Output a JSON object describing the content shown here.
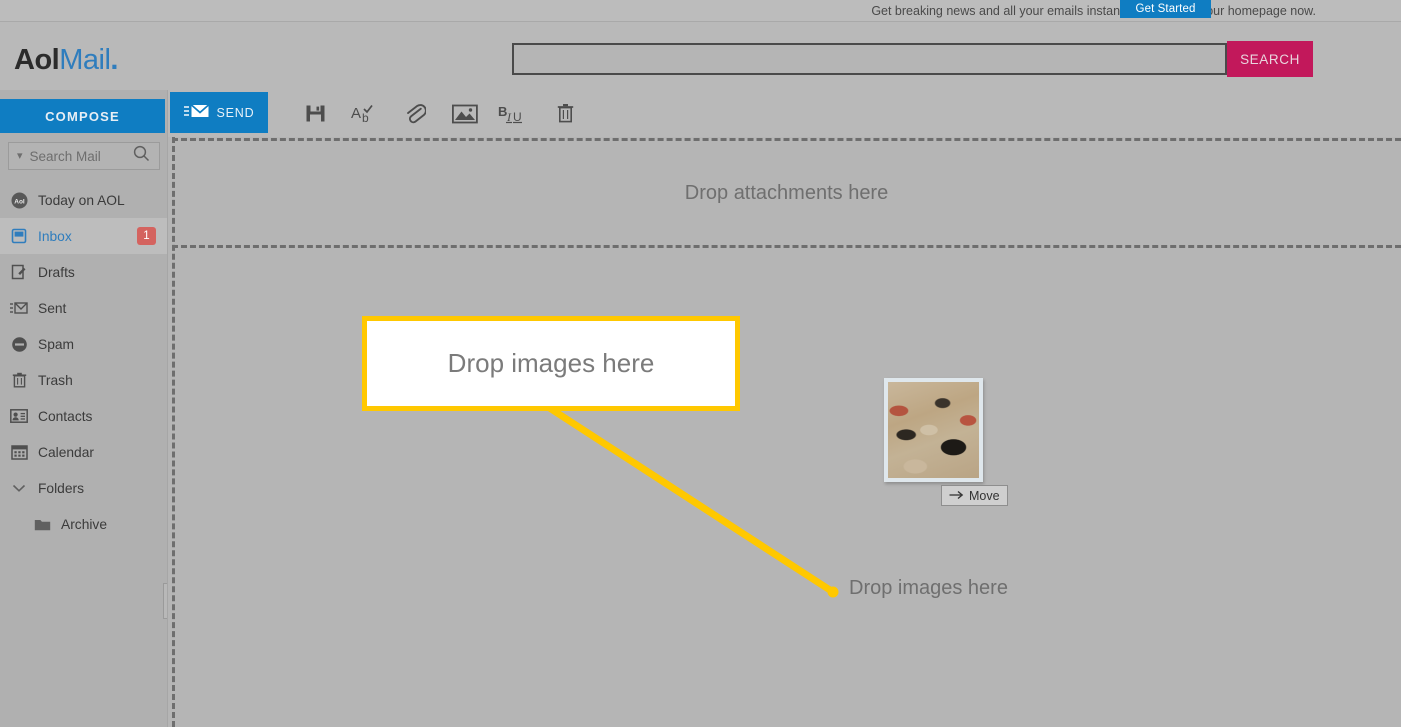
{
  "promo": {
    "text": "Get breaking news and all your emails instantly. Make AOL your homepage now.",
    "button_label": "Get Started",
    "button_color": "#0f7dc2"
  },
  "header": {
    "brand_first": "Aol",
    "brand_second": "Mail",
    "brand_dot": ".",
    "brand_color_primary": "#2b2b2b",
    "brand_color_secondary": "#2f7dbd",
    "search_value": "",
    "search_placeholder": "",
    "search_button_label": "SEARCH",
    "search_button_color": "#c2185b"
  },
  "sidebar": {
    "compose_label": "COMPOSE",
    "compose_color": "#0f7dc2",
    "search_mail_placeholder": "Search Mail",
    "items": [
      {
        "label": "Today on AOL",
        "icon": "aol-icon",
        "active": false,
        "badge": ""
      },
      {
        "label": "Inbox",
        "icon": "inbox-icon",
        "active": true,
        "badge": "1"
      },
      {
        "label": "Drafts",
        "icon": "drafts-icon",
        "active": false,
        "badge": ""
      },
      {
        "label": "Sent",
        "icon": "sent-icon",
        "active": false,
        "badge": ""
      },
      {
        "label": "Spam",
        "icon": "spam-icon",
        "active": false,
        "badge": ""
      },
      {
        "label": "Trash",
        "icon": "trash-icon",
        "active": false,
        "badge": ""
      },
      {
        "label": "Contacts",
        "icon": "contacts-icon",
        "active": false,
        "badge": ""
      },
      {
        "label": "Calendar",
        "icon": "calendar-icon",
        "active": false,
        "badge": ""
      },
      {
        "label": "Folders",
        "icon": "chevron-down-icon",
        "active": false,
        "badge": ""
      },
      {
        "label": "Archive",
        "icon": "folder-icon",
        "active": false,
        "badge": ""
      }
    ],
    "badge_color": "#d4635f"
  },
  "toolbar": {
    "send_label": "SEND",
    "icons": [
      {
        "name": "save-icon"
      },
      {
        "name": "spellcheck-icon"
      },
      {
        "name": "attachment-paperclip-icon"
      },
      {
        "name": "insert-image-icon"
      },
      {
        "name": "text-format-icon"
      },
      {
        "name": "delete-trash-icon"
      }
    ]
  },
  "compose": {
    "attachment_zone_text": "Drop attachments here",
    "body_drop_text": "Drop images here"
  },
  "dragged_item": {
    "move_label": "Move",
    "move_icon": "arrow-right-icon"
  },
  "annotation": {
    "callout_text": "Drop images here",
    "callout_border_color": "#ffc800",
    "callout_bg": "#ffffff",
    "line_color": "#ffc800"
  }
}
